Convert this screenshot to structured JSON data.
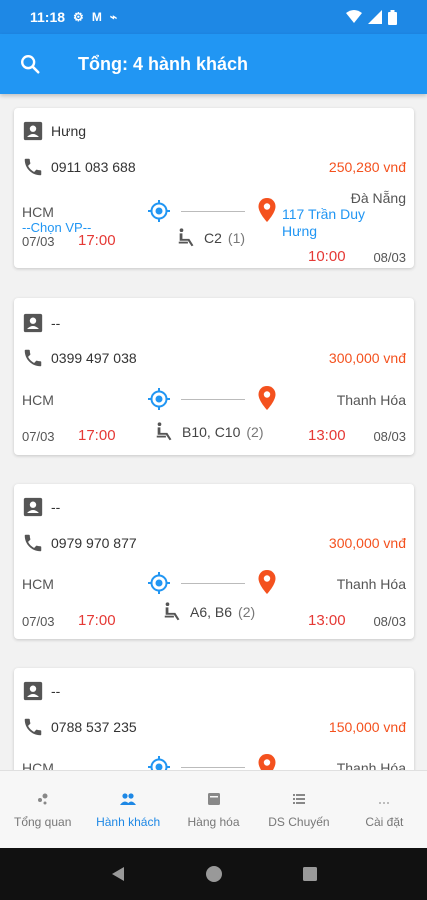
{
  "status_bar": {
    "time": "11:18"
  },
  "app_bar": {
    "title": "Tổng: 4 hành khách"
  },
  "passengers": [
    {
      "name": "Hưng",
      "phone": "0911 083 688",
      "price": "250,280 vnđ",
      "from": "HCM",
      "from_sub": "--Chọn VP--",
      "to": "Đà Nẵng",
      "to_sub": "117 Trần Duy Hưng",
      "seats": "C2",
      "seat_count": "(1)",
      "date_from": "07/03",
      "time_from": "17:00",
      "time_to": "10:00",
      "date_to": "08/03"
    },
    {
      "name": "--",
      "phone": "0399 497 038",
      "price": "300,000 vnđ",
      "from": "HCM",
      "to": "Thanh Hóa",
      "seats": "B10, C10",
      "seat_count": "(2)",
      "date_from": "07/03",
      "time_from": "17:00",
      "time_to": "13:00",
      "date_to": "08/03"
    },
    {
      "name": "--",
      "phone": "0979 970 877",
      "price": "300,000 vnđ",
      "from": "HCM",
      "to": "Thanh Hóa",
      "seats": "A6, B6",
      "seat_count": "(2)",
      "date_from": "07/03",
      "time_from": "17:00",
      "time_to": "13:00",
      "date_to": "08/03"
    },
    {
      "name": "--",
      "phone": "0788 537 235",
      "price": "150,000 vnđ",
      "from": "HCM",
      "to": "Thanh Hóa"
    }
  ],
  "bottom_nav": [
    {
      "label": "Tổng quan",
      "icon": "overview-icon"
    },
    {
      "label": "Hành khách",
      "icon": "people-icon",
      "active": true
    },
    {
      "label": "Hàng hóa",
      "icon": "cargo-icon"
    },
    {
      "label": "DS Chuyến",
      "icon": "list-icon"
    },
    {
      "label": "Cài đặt",
      "icon": "more-icon"
    }
  ],
  "colors": {
    "primary": "#2196f3",
    "status_bar": "#1e88e5",
    "price": "#f4511e",
    "time": "#e53935",
    "link": "#2196f3"
  }
}
